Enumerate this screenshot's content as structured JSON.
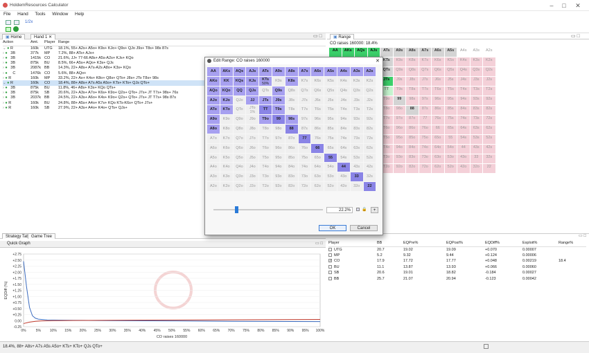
{
  "window": {
    "title": "HoldemResources Calculator"
  },
  "menu": [
    "File",
    "Hand",
    "Tools",
    "Window",
    "Help"
  ],
  "toolbar": {
    "zoom": "1/2x"
  },
  "tabs": {
    "home": "Home",
    "hand": "Hand 1",
    "range": "Range",
    "strategy": "Strategy Table",
    "gametree": "Game Tree"
  },
  "actions": {
    "headers": [
      "Action",
      "Amt.",
      "Player",
      "Range"
    ],
    "rows": [
      {
        "a": "R",
        "amt": "160k",
        "player": "UTG",
        "range": "18.1%, 55+ A2s+ A5o+ K9s+ KJo+ Q9s+ QJo J9s+ T8s+ 98s 87s",
        "hl": false
      },
      {
        "a": "3B",
        "amt": "377k",
        "player": "MP",
        "range": "7.2%, 88+ ATs+ AJo+",
        "hl": false
      },
      {
        "a": "3B",
        "amt": "1415k",
        "player": "CO",
        "range": "21.6%, JJ+ 77-66 A8s+ A5s-A2s+ KJs+ KQo",
        "hl": false
      },
      {
        "a": "3B",
        "amt": "875k",
        "player": "BU",
        "range": "8.5%, 66+ A5s+ AQo+ K3s+ QJs",
        "hl": false
      },
      {
        "a": "3B",
        "amt": "2087k",
        "player": "BB",
        "range": "14.3%, 22+ A8s+ A7s-A2s A8o+ K3s+ KQo",
        "hl": false
      },
      {
        "a": "C",
        "amt": "1476k",
        "player": "CO",
        "range": "5.6%, 88+ AQo+",
        "hl": false
      },
      {
        "a": "R",
        "amt": "160k",
        "player": "MP",
        "range": "33.2%, 22+ Ax+ K4s+ K8o+ Q8s+ QTo+ J8s+ JTo T8s+ 98s",
        "hl": false
      },
      {
        "a": "R",
        "amt": "160k",
        "player": "CO",
        "range": "18.4%, 88+ A8s+ A7s A5s A5o+ KTs+ KTo+ QJs QTo+",
        "hl": true
      },
      {
        "a": "3B",
        "amt": "875k",
        "player": "BU",
        "range": "11.8%, 46+ A8s+ K3s+ KQo QTs+",
        "hl": false
      },
      {
        "a": "3B",
        "amt": "875k",
        "player": "SB",
        "range": "20.6%, 22+ A3s+ A7o+ K6s+ K9o+ Q2s+ QTo+ J7s+ JT T7s+ 98s+ 76s",
        "hl": false
      },
      {
        "a": "3B",
        "amt": "2037k",
        "player": "BB",
        "range": "24.5%, 22+ A3s+ A6o+ K4s+ K9o+ Q2s+ QTo+ J7s+ JT T7s+ 98s 87s",
        "hl": false
      },
      {
        "a": "R",
        "amt": "160k",
        "player": "BU",
        "range": "24.8%, 88+ A5s+ A4o+ K7s+ KQo KTs-K6s+ QTo+ J7s+",
        "hl": false
      },
      {
        "a": "R",
        "amt": "160k",
        "player": "SB",
        "range": "27.9%, 22+ A3s+ A4o+ K4o+ QTs+ QJs+",
        "hl": false
      }
    ]
  },
  "range_panel": {
    "header": "CO raises 160000: 18.4%",
    "grid": [
      [
        "AA",
        "AKs",
        "AQs",
        "AJs",
        "ATs",
        "A9s",
        "A8s",
        "A7s",
        "A6s",
        "A5s",
        "A4s",
        "A3s",
        "A2s"
      ],
      [
        "AKo",
        "KK",
        "KQs",
        "KJs",
        "KTs",
        "K9s",
        "K8s",
        "K7s",
        "K6s",
        "K5s",
        "K4s",
        "K3s",
        "K2s"
      ],
      [
        "AQo",
        "KQo",
        "QQ",
        "QJs",
        "QTs",
        "Q9s",
        "Q8s",
        "Q7s",
        "Q6s",
        "Q5s",
        "Q4s",
        "Q3s",
        "Q2s"
      ],
      [
        "AJo",
        "KJo",
        "QJo",
        "JJ",
        "JTs",
        "J9s",
        "J8s",
        "J7s",
        "J6s",
        "J5s",
        "J4s",
        "J3s",
        "J2s"
      ],
      [
        "ATo",
        "KTo",
        "QTo",
        "JTo",
        "TT",
        "T9s",
        "T8s",
        "T7s",
        "T6s",
        "T5s",
        "T4s",
        "T3s",
        "T2s"
      ],
      [
        "A9o",
        "K9o",
        "Q9o",
        "J9o",
        "T9o",
        "99",
        "98s",
        "97s",
        "96s",
        "95s",
        "94s",
        "93s",
        "92s"
      ],
      [
        "A8o",
        "K8o",
        "Q8o",
        "J8o",
        "T8o",
        "98o",
        "88",
        "87s",
        "86s",
        "85s",
        "84s",
        "83s",
        "82s"
      ],
      [
        "A7o",
        "K7o",
        "Q7o",
        "J7o",
        "T7o",
        "97o",
        "87o",
        "77",
        "76s",
        "75s",
        "74s",
        "73s",
        "72s"
      ],
      [
        "A6o",
        "K6o",
        "Q6o",
        "J6o",
        "T6o",
        "96o",
        "86o",
        "76o",
        "66",
        "65s",
        "64s",
        "63s",
        "62s"
      ],
      [
        "A5o",
        "K5o",
        "Q5o",
        "J5o",
        "T5o",
        "95o",
        "85o",
        "75o",
        "65o",
        "55",
        "54s",
        "53s",
        "52s"
      ],
      [
        "A4o",
        "K4o",
        "Q4o",
        "J4o",
        "T4o",
        "94o",
        "84o",
        "74o",
        "64o",
        "54o",
        "44",
        "43s",
        "42s"
      ],
      [
        "A3o",
        "K3o",
        "Q3o",
        "J3o",
        "T3o",
        "93o",
        "83o",
        "73o",
        "63o",
        "53o",
        "43o",
        "33",
        "32s"
      ],
      [
        "A2o",
        "K2o",
        "Q2o",
        "J2o",
        "T2o",
        "92o",
        "82o",
        "72o",
        "62o",
        "52o",
        "42o",
        "32o",
        "22"
      ]
    ]
  },
  "dialog": {
    "title": "Edit Range: CO raises 160000",
    "kts_pct": "50%",
    "jts_pct": "1%",
    "slider_value": "22.2%",
    "ok": "OK",
    "cancel": "Cancel"
  },
  "equity": {
    "headers": [
      "Player",
      "BB",
      "EQPre%",
      "EQPost%",
      "EQDiff%",
      "Exploit%",
      "Range%"
    ],
    "rows": [
      {
        "p": "UTG",
        "bb": "20.7",
        "pre": "19.02",
        "post": "19.09",
        "diff": "+0.070",
        "ex": "0.00007",
        "r": "",
        "c": false
      },
      {
        "p": "MP",
        "bb": "5.2",
        "pre": "9.32",
        "post": "9.44",
        "diff": "+0.124",
        "ex": "0.00006",
        "r": "",
        "c": false
      },
      {
        "p": "CO",
        "bb": "17.9",
        "pre": "17.72",
        "post": "17.77",
        "diff": "+0.048",
        "ex": "0.00219",
        "r": "18.4",
        "c": true
      },
      {
        "p": "BU",
        "bb": "11.1",
        "pre": "13.87",
        "post": "13.93",
        "diff": "+0.066",
        "ex": "0.00060",
        "r": "",
        "c": false
      },
      {
        "p": "SB",
        "bb": "20.6",
        "pre": "19.01",
        "post": "18.82",
        "diff": "-0.184",
        "ex": "0.00027",
        "r": "",
        "c": false
      },
      {
        "p": "BB",
        "bb": "25.7",
        "pre": "21.07",
        "post": "20.94",
        "diff": "-0.123",
        "ex": "0.00042",
        "r": "",
        "c": false
      }
    ]
  },
  "quickgraph": {
    "title": "Quick Graph",
    "xlabel": "CO raises 160000",
    "ylabel": "EQDiff (%)",
    "yticks": [
      "+2.75",
      "+2.50",
      "+2.25",
      "+2.00",
      "+1.75",
      "+1.50",
      "+1.25",
      "+1.00",
      "+0.75",
      "+0.50",
      "+0.25",
      "0.00",
      "-0.25"
    ],
    "xticks": [
      "0%",
      "5%",
      "10%",
      "15%",
      "20%",
      "25%",
      "30%",
      "35%",
      "40%",
      "45%",
      "50%",
      "55%",
      "60%",
      "65%",
      "70%",
      "75%",
      "80%",
      "85%",
      "90%",
      "95%",
      "100%"
    ]
  },
  "chart_data": {
    "type": "line",
    "xlabel": "CO raises 160000",
    "ylabel": "EQDiff (%)",
    "ylim": [
      -0.25,
      2.75
    ],
    "xlim": [
      0,
      100
    ],
    "series": [
      {
        "color": "#3b6bbf",
        "x": [
          0,
          1,
          2,
          3,
          4,
          5,
          8,
          12,
          20,
          30,
          50,
          70,
          100
        ],
        "y": [
          2.45,
          1.4,
          0.55,
          0.2,
          0.1,
          0.06,
          0.03,
          0.02,
          0.01,
          0.0,
          -0.01,
          -0.03,
          -0.04
        ]
      },
      {
        "color": "#c0392b",
        "x": [
          0,
          2,
          4,
          6,
          10,
          20,
          40,
          60,
          80,
          100
        ],
        "y": [
          -0.12,
          -0.06,
          -0.03,
          -0.01,
          0.0,
          0.01,
          0.02,
          0.03,
          0.04,
          0.05
        ]
      }
    ]
  },
  "status": "18.4%, 88+ A8s+ A7s A5s A5o+ KTs+ KTo+ QJs QTo+"
}
